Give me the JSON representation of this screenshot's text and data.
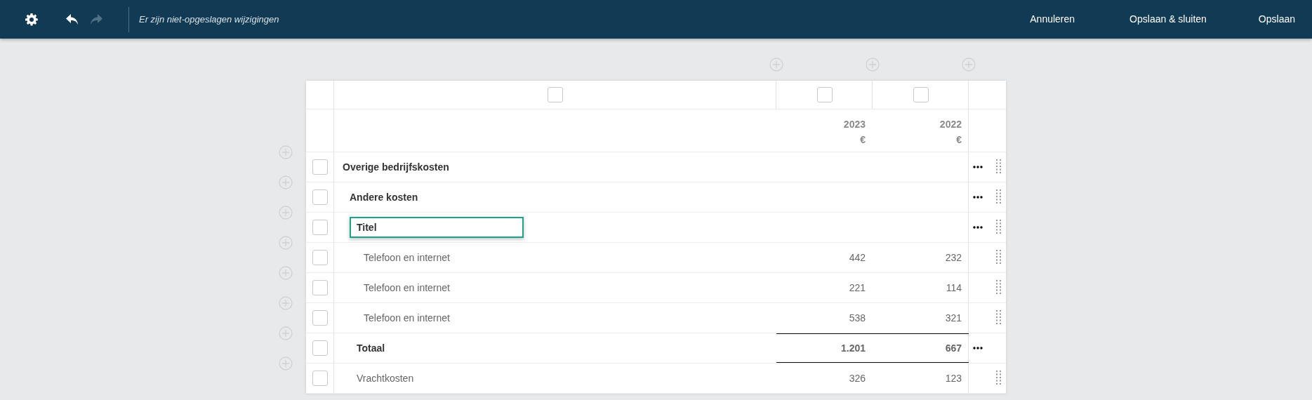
{
  "toolbar": {
    "undo": {
      "disabled": false
    },
    "redo": {
      "disabled": true
    },
    "status": "Er zijn niet-opgeslagen wijzigingen",
    "actions": [
      "Annuleren",
      "Opslaan & sluiten",
      "Opslaan"
    ]
  },
  "table": {
    "label_column": {
      "checked": false
    },
    "columns": [
      {
        "checked": false,
        "year": "2023",
        "currency": "€"
      },
      {
        "checked": false,
        "year": "2022",
        "currency": "€"
      }
    ],
    "rows": [
      {
        "kind": "group",
        "label": "Overige bedrijfskosten",
        "checked": false,
        "menu": true,
        "draggable": true,
        "children": [
          {
            "kind": "group",
            "label": "Andere kosten",
            "checked": false,
            "menu": true,
            "draggable": true,
            "children": [
              {
                "kind": "title-input",
                "value": "Titel",
                "checked": false,
                "menu": true,
                "draggable": true,
                "children": [
                  {
                    "kind": "item",
                    "label": "Telefoon en internet",
                    "values": [
                      "442",
                      "232"
                    ],
                    "checked": false,
                    "menu": false,
                    "draggable": true
                  },
                  {
                    "kind": "item",
                    "label": "Telefoon en internet",
                    "values": [
                      "221",
                      "114"
                    ],
                    "checked": false,
                    "menu": false,
                    "draggable": true
                  },
                  {
                    "kind": "item",
                    "label": "Telefoon en internet",
                    "values": [
                      "538",
                      "321"
                    ],
                    "checked": false,
                    "menu": false,
                    "draggable": true
                  }
                ]
              },
              {
                "kind": "total",
                "label": "Totaal",
                "values": [
                  "1.201",
                  "667"
                ],
                "checked": false,
                "menu": true,
                "draggable": false
              },
              {
                "kind": "item",
                "label": "Vrachtkosten",
                "values": [
                  "326",
                  "123"
                ],
                "checked": false,
                "menu": false,
                "draggable": true
              }
            ]
          }
        ]
      }
    ]
  }
}
